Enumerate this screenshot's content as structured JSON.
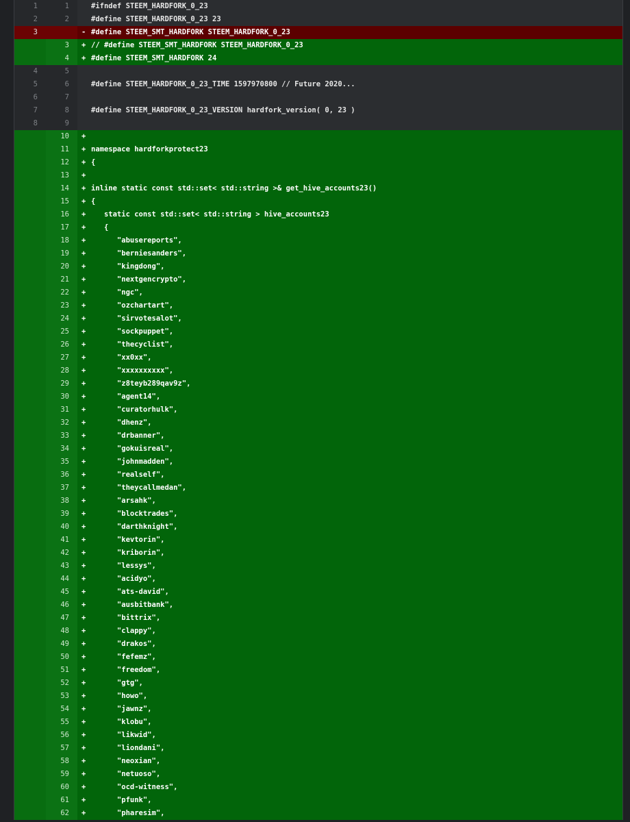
{
  "lines": [
    {
      "type": "context",
      "old": "1",
      "new": "1",
      "text": "#ifndef STEEM_HARDFORK_0_23"
    },
    {
      "type": "context",
      "old": "2",
      "new": "2",
      "text": "#define STEEM_HARDFORK_0_23 23"
    },
    {
      "type": "del",
      "old": "3",
      "new": "",
      "text": "#define STEEM_SMT_HARDFORK STEEM_HARDFORK_0_23"
    },
    {
      "type": "add",
      "old": "",
      "new": "3",
      "text": "// #define STEEM_SMT_HARDFORK STEEM_HARDFORK_0_23"
    },
    {
      "type": "add",
      "old": "",
      "new": "4",
      "text": "#define STEEM_SMT_HARDFORK 24"
    },
    {
      "type": "context",
      "old": "4",
      "new": "5",
      "text": ""
    },
    {
      "type": "context",
      "old": "5",
      "new": "6",
      "text": "#define STEEM_HARDFORK_0_23_TIME 1597970800 // Future 2020..."
    },
    {
      "type": "context",
      "old": "6",
      "new": "7",
      "text": ""
    },
    {
      "type": "context",
      "old": "7",
      "new": "8",
      "text": "#define STEEM_HARDFORK_0_23_VERSION hardfork_version( 0, 23 )"
    },
    {
      "type": "context",
      "old": "8",
      "new": "9",
      "text": ""
    },
    {
      "type": "add",
      "old": "",
      "new": "10",
      "text": ""
    },
    {
      "type": "add",
      "old": "",
      "new": "11",
      "text": "namespace hardforkprotect23"
    },
    {
      "type": "add",
      "old": "",
      "new": "12",
      "text": "{"
    },
    {
      "type": "add",
      "old": "",
      "new": "13",
      "text": ""
    },
    {
      "type": "add",
      "old": "",
      "new": "14",
      "text": "inline static const std::set< std::string >& get_hive_accounts23()"
    },
    {
      "type": "add",
      "old": "",
      "new": "15",
      "text": "{"
    },
    {
      "type": "add",
      "old": "",
      "new": "16",
      "text": "   static const std::set< std::string > hive_accounts23"
    },
    {
      "type": "add",
      "old": "",
      "new": "17",
      "text": "   {"
    },
    {
      "type": "add",
      "old": "",
      "new": "18",
      "text": "      \"abusereports\","
    },
    {
      "type": "add",
      "old": "",
      "new": "19",
      "text": "      \"berniesanders\","
    },
    {
      "type": "add",
      "old": "",
      "new": "20",
      "text": "      \"kingdong\","
    },
    {
      "type": "add",
      "old": "",
      "new": "21",
      "text": "      \"nextgencrypto\","
    },
    {
      "type": "add",
      "old": "",
      "new": "22",
      "text": "      \"ngc\","
    },
    {
      "type": "add",
      "old": "",
      "new": "23",
      "text": "      \"ozchartart\","
    },
    {
      "type": "add",
      "old": "",
      "new": "24",
      "text": "      \"sirvotesalot\","
    },
    {
      "type": "add",
      "old": "",
      "new": "25",
      "text": "      \"sockpuppet\","
    },
    {
      "type": "add",
      "old": "",
      "new": "26",
      "text": "      \"thecyclist\","
    },
    {
      "type": "add",
      "old": "",
      "new": "27",
      "text": "      \"xx0xx\","
    },
    {
      "type": "add",
      "old": "",
      "new": "28",
      "text": "      \"xxxxxxxxxx\","
    },
    {
      "type": "add",
      "old": "",
      "new": "29",
      "text": "      \"z8teyb289qav9z\","
    },
    {
      "type": "add",
      "old": "",
      "new": "30",
      "text": "      \"agent14\","
    },
    {
      "type": "add",
      "old": "",
      "new": "31",
      "text": "      \"curatorhulk\","
    },
    {
      "type": "add",
      "old": "",
      "new": "32",
      "text": "      \"dhenz\","
    },
    {
      "type": "add",
      "old": "",
      "new": "33",
      "text": "      \"drbanner\","
    },
    {
      "type": "add",
      "old": "",
      "new": "34",
      "text": "      \"gokuisreal\","
    },
    {
      "type": "add",
      "old": "",
      "new": "35",
      "text": "      \"johnmadden\","
    },
    {
      "type": "add",
      "old": "",
      "new": "36",
      "text": "      \"realself\","
    },
    {
      "type": "add",
      "old": "",
      "new": "37",
      "text": "      \"theycallmedan\","
    },
    {
      "type": "add",
      "old": "",
      "new": "38",
      "text": "      \"arsahk\","
    },
    {
      "type": "add",
      "old": "",
      "new": "39",
      "text": "      \"blocktrades\","
    },
    {
      "type": "add",
      "old": "",
      "new": "40",
      "text": "      \"darthknight\","
    },
    {
      "type": "add",
      "old": "",
      "new": "41",
      "text": "      \"kevtorin\","
    },
    {
      "type": "add",
      "old": "",
      "new": "42",
      "text": "      \"kriborin\","
    },
    {
      "type": "add",
      "old": "",
      "new": "43",
      "text": "      \"lessys\","
    },
    {
      "type": "add",
      "old": "",
      "new": "44",
      "text": "      \"acidyo\","
    },
    {
      "type": "add",
      "old": "",
      "new": "45",
      "text": "      \"ats-david\","
    },
    {
      "type": "add",
      "old": "",
      "new": "46",
      "text": "      \"ausbitbank\","
    },
    {
      "type": "add",
      "old": "",
      "new": "47",
      "text": "      \"bittrix\","
    },
    {
      "type": "add",
      "old": "",
      "new": "48",
      "text": "      \"clappy\","
    },
    {
      "type": "add",
      "old": "",
      "new": "49",
      "text": "      \"drakos\","
    },
    {
      "type": "add",
      "old": "",
      "new": "50",
      "text": "      \"fefemz\","
    },
    {
      "type": "add",
      "old": "",
      "new": "51",
      "text": "      \"freedom\","
    },
    {
      "type": "add",
      "old": "",
      "new": "52",
      "text": "      \"gtg\","
    },
    {
      "type": "add",
      "old": "",
      "new": "53",
      "text": "      \"howo\","
    },
    {
      "type": "add",
      "old": "",
      "new": "54",
      "text": "      \"jawnz\","
    },
    {
      "type": "add",
      "old": "",
      "new": "55",
      "text": "      \"klobu\","
    },
    {
      "type": "add",
      "old": "",
      "new": "56",
      "text": "      \"likwid\","
    },
    {
      "type": "add",
      "old": "",
      "new": "57",
      "text": "      \"liondani\","
    },
    {
      "type": "add",
      "old": "",
      "new": "58",
      "text": "      \"neoxian\","
    },
    {
      "type": "add",
      "old": "",
      "new": "59",
      "text": "      \"netuoso\","
    },
    {
      "type": "add",
      "old": "",
      "new": "60",
      "text": "      \"ocd-witness\","
    },
    {
      "type": "add",
      "old": "",
      "new": "61",
      "text": "      \"pfunk\","
    },
    {
      "type": "add",
      "old": "",
      "new": "62",
      "text": "      \"pharesim\","
    }
  ]
}
